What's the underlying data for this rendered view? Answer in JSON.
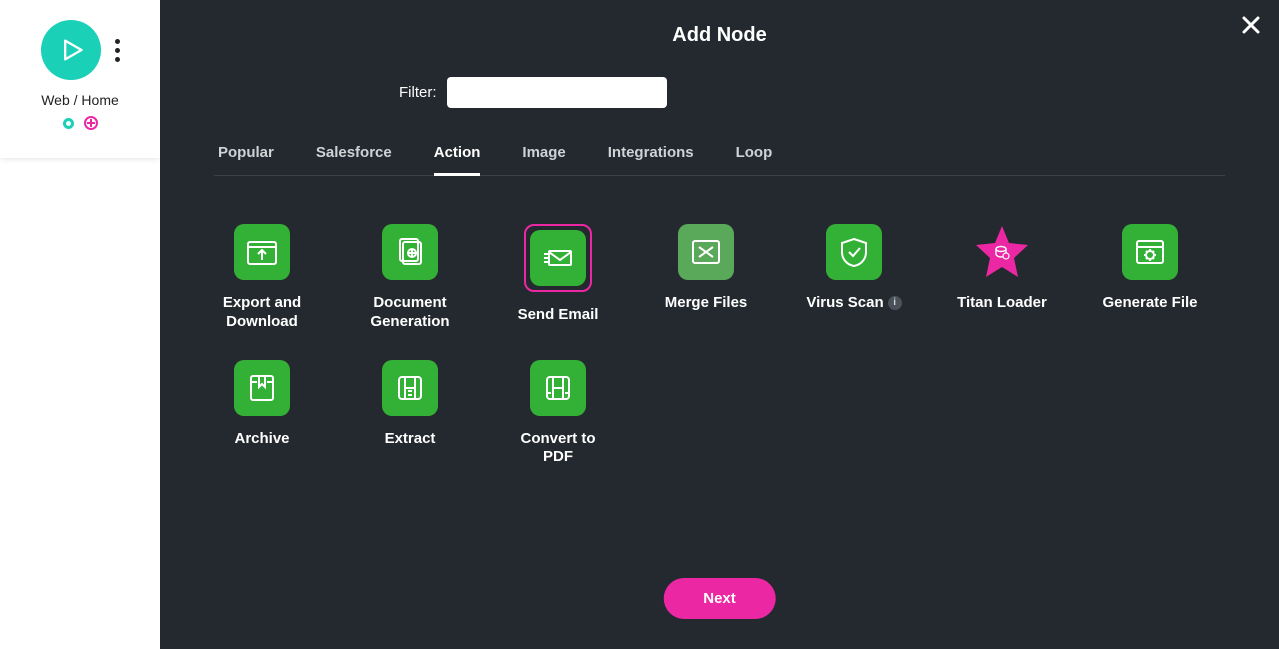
{
  "sidebar": {
    "label": "Web / Home"
  },
  "modal": {
    "title": "Add Node",
    "filter_label": "Filter:",
    "filter_value": "",
    "next_label": "Next"
  },
  "tabs": [
    {
      "label": "Popular",
      "active": false
    },
    {
      "label": "Salesforce",
      "active": false
    },
    {
      "label": "Action",
      "active": true
    },
    {
      "label": "Image",
      "active": false
    },
    {
      "label": "Integrations",
      "active": false
    },
    {
      "label": "Loop",
      "active": false
    }
  ],
  "nodes": [
    {
      "label": "Export and Download",
      "icon": "upload-folder",
      "selected": false,
      "style": "green"
    },
    {
      "label": "Document Generation",
      "icon": "doc-stack",
      "selected": false,
      "style": "green"
    },
    {
      "label": "Send Email",
      "icon": "email",
      "selected": true,
      "style": "green"
    },
    {
      "label": "Merge Files",
      "icon": "merge",
      "selected": false,
      "style": "muted"
    },
    {
      "label": "Virus Scan",
      "icon": "shield-check",
      "selected": false,
      "style": "green",
      "info": true
    },
    {
      "label": "Titan Loader",
      "icon": "star-db",
      "selected": false,
      "style": "star"
    },
    {
      "label": "Generate File",
      "icon": "window-gear",
      "selected": false,
      "style": "green"
    },
    {
      "label": "Archive",
      "icon": "archive",
      "selected": false,
      "style": "green"
    },
    {
      "label": "Extract",
      "icon": "extract",
      "selected": false,
      "style": "green"
    },
    {
      "label": "Convert to PDF",
      "icon": "convert-pdf",
      "selected": false,
      "style": "green"
    }
  ],
  "colors": {
    "accent_teal": "#1ad1b8",
    "accent_pink": "#ec27a4",
    "node_green": "#33b136",
    "panel_bg": "#23292e"
  }
}
